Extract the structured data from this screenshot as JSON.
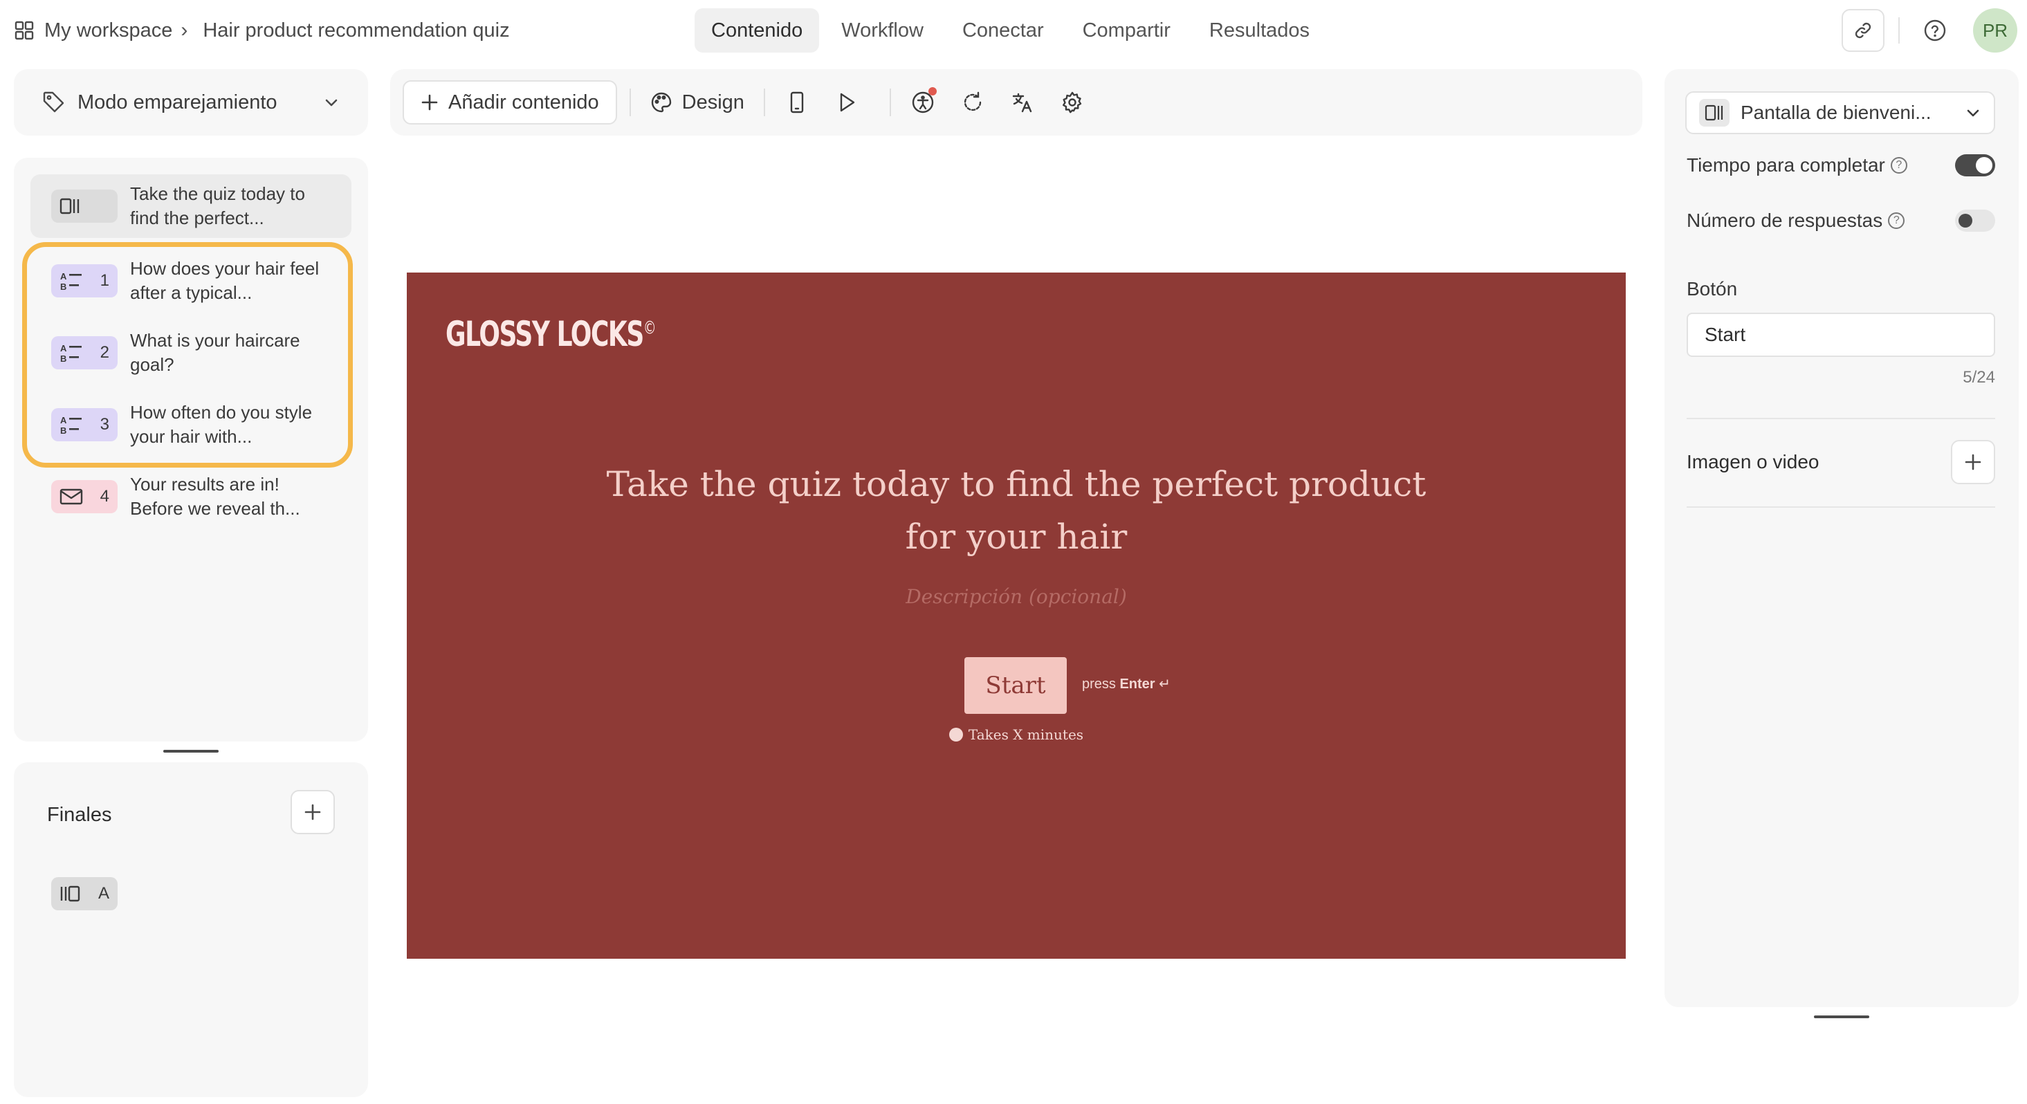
{
  "breadcrumb": {
    "workspace": "My workspace",
    "separator": "›",
    "title": "Hair product recommendation quiz"
  },
  "nav": {
    "tabs": [
      "Contenido",
      "Workflow",
      "Conectar",
      "Compartir",
      "Resultados"
    ],
    "active": "Contenido"
  },
  "user": {
    "initials": "PR"
  },
  "left": {
    "mode": "Modo emparejamiento",
    "items": [
      {
        "type": "welcome",
        "number": "",
        "text": "Take the quiz today to find the perfect..."
      },
      {
        "type": "multiple-choice",
        "number": "1",
        "text": "How does your hair feel after a typical..."
      },
      {
        "type": "multiple-choice",
        "number": "2",
        "text": "What is your haircare goal?"
      },
      {
        "type": "multiple-choice",
        "number": "3",
        "text": "How often do you style your hair with..."
      },
      {
        "type": "email",
        "number": "4",
        "text": "Your results are in! Before we reveal th..."
      }
    ],
    "finales": {
      "label": "Finales",
      "ending_letter": "A"
    }
  },
  "toolbar": {
    "add_label": "Añadir contenido",
    "design_label": "Design"
  },
  "preview": {
    "brand": "GLOSSY LOCKS",
    "brand_mark": "©",
    "headline_line1": "Take the quiz today to find the perfect product",
    "headline_line2": "for your hair",
    "description_placeholder": "Descripción (opcional)",
    "button": "Start",
    "press_prefix": "press",
    "press_key": "Enter",
    "press_glyph": "↵",
    "takes": "Takes X minutes",
    "colors": {
      "background": "#8e3a36",
      "button": "#f4c6c0",
      "text": "#f4cfc9"
    }
  },
  "right": {
    "screen_select": "Pantalla de bienveni...",
    "time_to_complete": {
      "label": "Tiempo para completar",
      "on": true
    },
    "response_count": {
      "label": "Número de respuestas",
      "on": false
    },
    "button_label": "Botón",
    "button_value": "Start",
    "char_count": "5/24",
    "media_label": "Imagen o video"
  },
  "colors": {
    "highlight": "#f5b84a",
    "avatar_bg": "#cfe6c8"
  }
}
